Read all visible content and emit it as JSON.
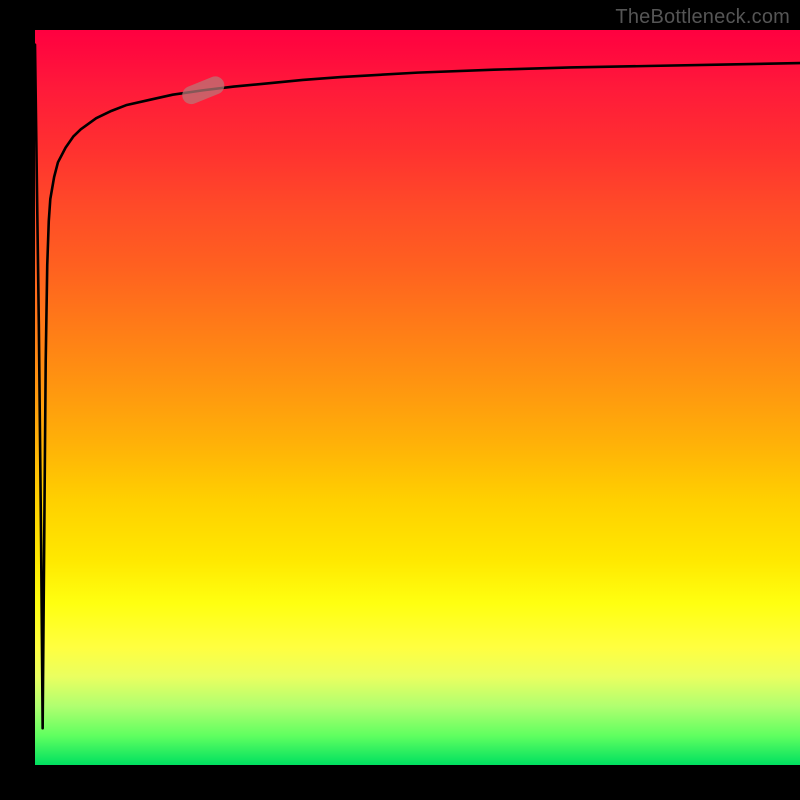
{
  "attribution": "TheBottleneck.com",
  "chart_data": {
    "type": "line",
    "title": "",
    "xlabel": "",
    "ylabel": "",
    "xlim": [
      0,
      100
    ],
    "ylim": [
      0,
      100
    ],
    "x": [
      0,
      0.5,
      0.8,
      1.0,
      1.2,
      1.4,
      1.6,
      1.8,
      2.0,
      2.5,
      3,
      4,
      5,
      6,
      8,
      10,
      12,
      15,
      18,
      22,
      26,
      30,
      35,
      40,
      50,
      60,
      70,
      80,
      90,
      100
    ],
    "y": [
      98,
      60,
      30,
      5,
      30,
      55,
      68,
      74,
      77,
      80,
      82,
      84,
      85.5,
      86.5,
      88,
      89,
      89.8,
      90.5,
      91.2,
      91.8,
      92.3,
      92.7,
      93.2,
      93.6,
      94.2,
      94.6,
      94.9,
      95.1,
      95.3,
      95.5
    ],
    "colors": {
      "curve": "#000000",
      "marker": "#b97878",
      "gradient_top": "#ff0040",
      "gradient_mid": "#ffe000",
      "gradient_bottom": "#00e060"
    },
    "marker": {
      "x": 22,
      "y": 91.8
    },
    "notes": "Y axis shown with 0 at bottom and 100 at top; values are estimates from pixel positions."
  }
}
